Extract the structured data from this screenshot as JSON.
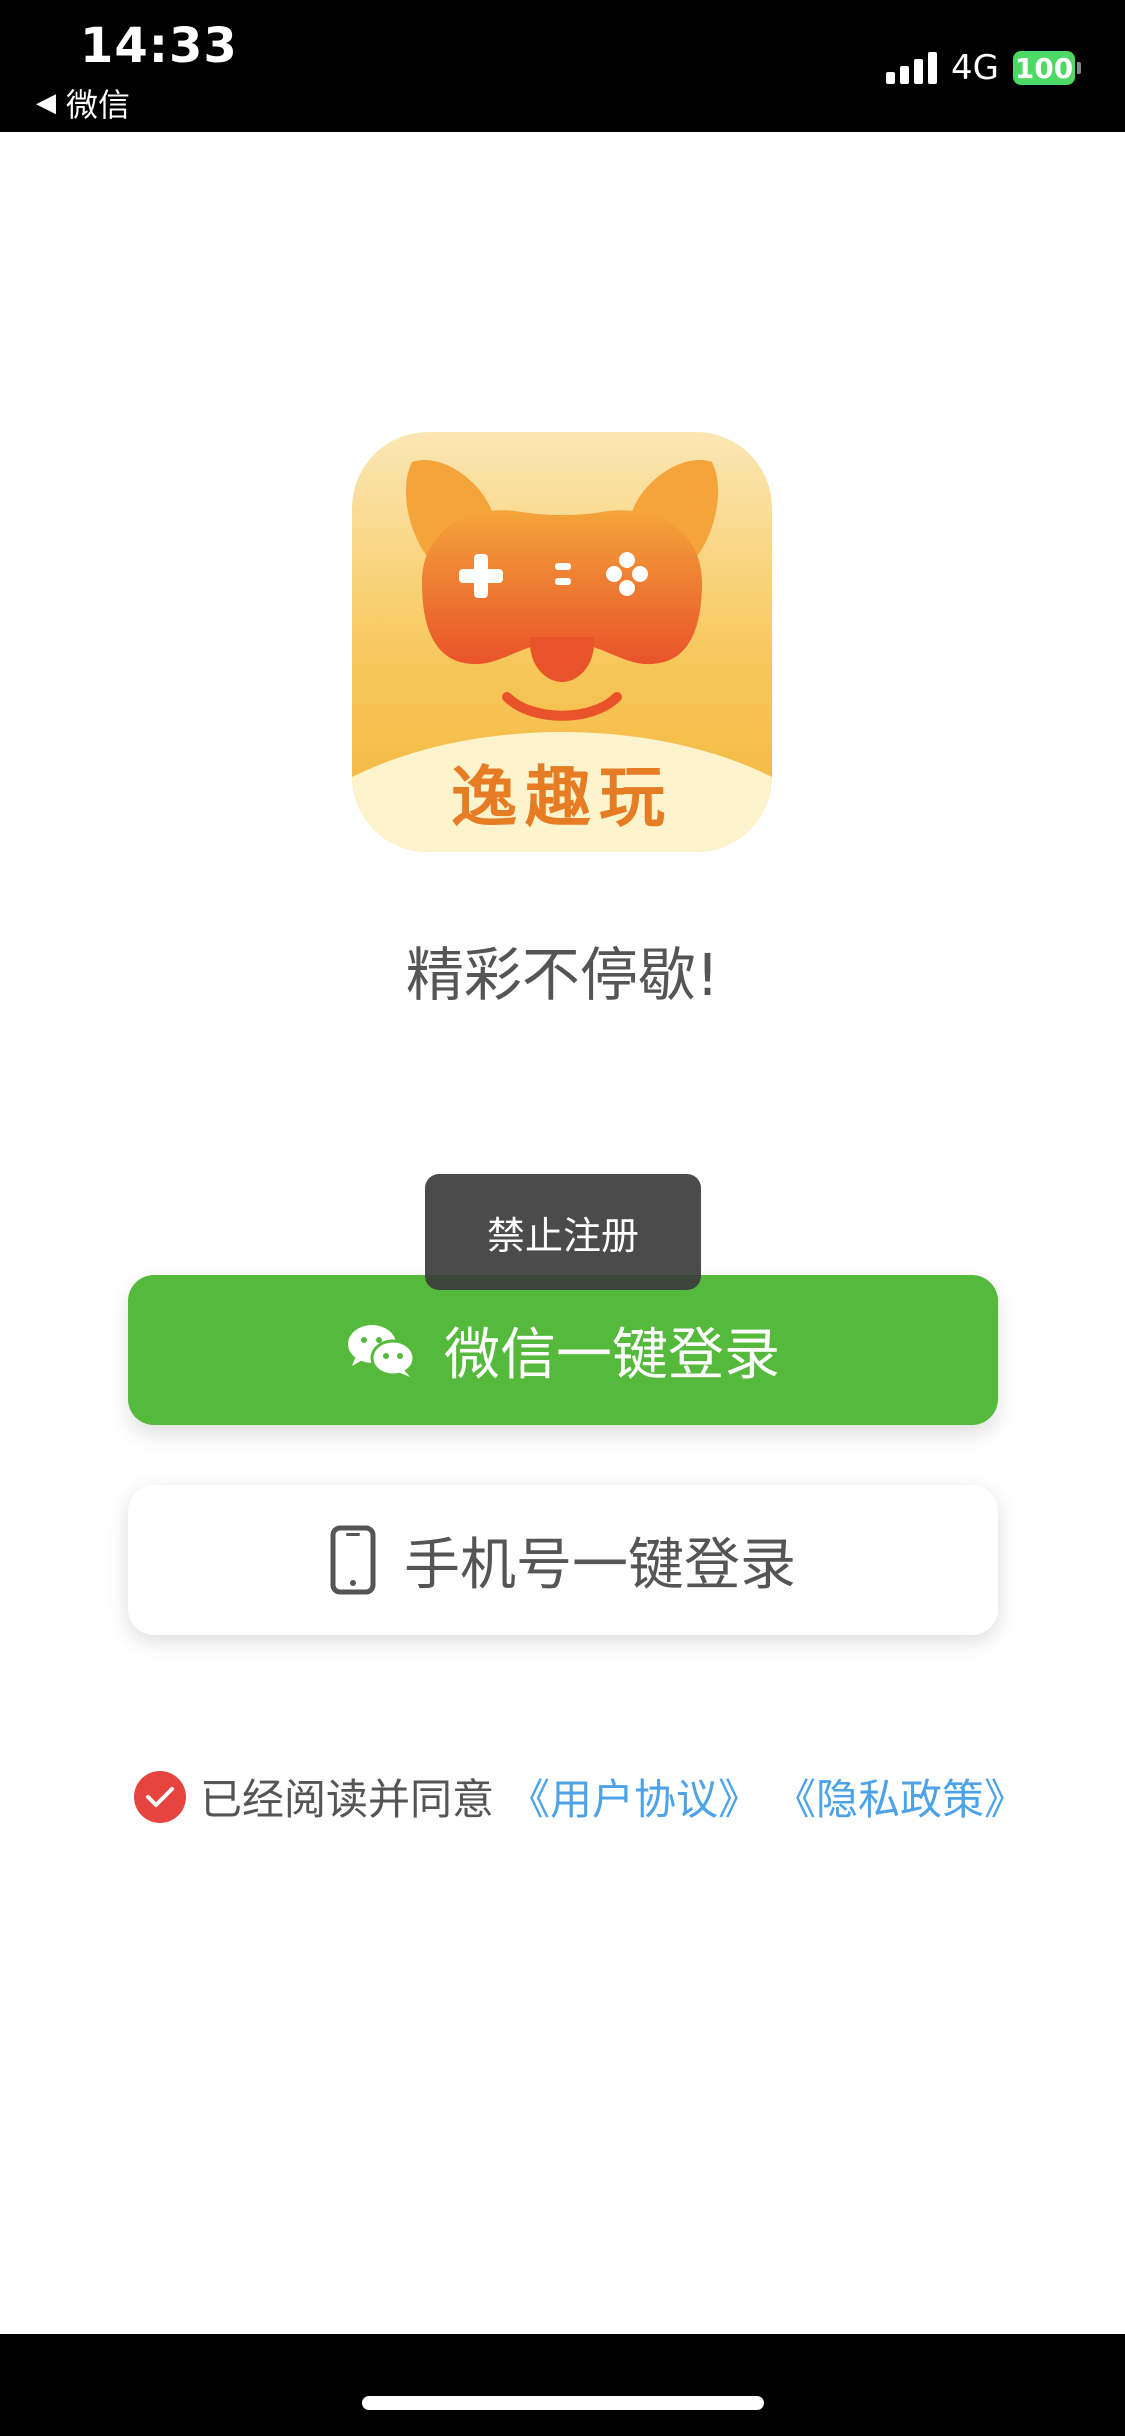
{
  "status_bar": {
    "time": "14:33",
    "back_label": "微信",
    "network": "4G",
    "battery": "100"
  },
  "app": {
    "logo_name": "逸趣玩",
    "slogan": "精彩不停歇!"
  },
  "toast": {
    "message": "禁止注册"
  },
  "buttons": {
    "wechat_login": "微信一键登录",
    "phone_login": "手机号一键登录"
  },
  "agreement": {
    "prefix": "已经阅读并同意",
    "user_agreement": "《用户协议》",
    "privacy_policy": "《隐私政策》"
  },
  "icons": {
    "back": "back-arrow-icon",
    "signal": "signal-icon",
    "battery": "battery-icon",
    "wechat": "wechat-icon",
    "phone": "phone-icon",
    "check": "check-icon"
  },
  "colors": {
    "wechat_green": "#55b93b",
    "link_blue": "#4ea3e8",
    "check_red": "#e8443f",
    "logo_orange": "#e67c24"
  }
}
